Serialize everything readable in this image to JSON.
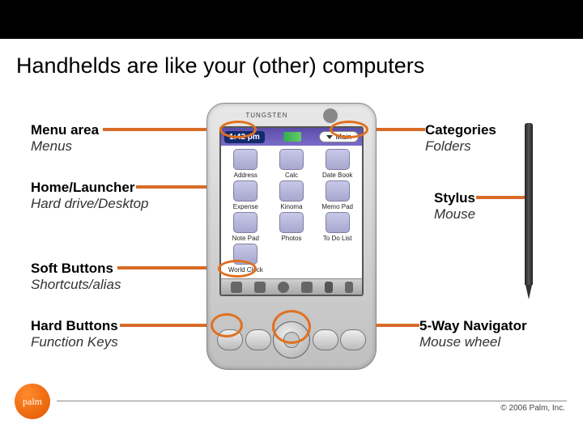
{
  "slide": {
    "title": "Handhelds are like your (other) computers"
  },
  "labels": {
    "menu_area": {
      "primary": "Menu area",
      "secondary": "Menus"
    },
    "home_launcher": {
      "primary": "Home/Launcher",
      "secondary": "Hard drive/Desktop"
    },
    "soft_buttons": {
      "primary": "Soft Buttons",
      "secondary": "Shortcuts/alias"
    },
    "hard_buttons": {
      "primary": "Hard Buttons",
      "secondary": "Function Keys"
    },
    "categories": {
      "primary": "Categories",
      "secondary": "Folders"
    },
    "stylus": {
      "primary": "Stylus",
      "secondary": "Mouse"
    },
    "navigator": {
      "primary": "5-Way Navigator",
      "secondary": "Mouse wheel"
    }
  },
  "device": {
    "model": "TUNGSTEN",
    "time": "1:42 pm",
    "main_button": "Main",
    "apps": [
      "Address",
      "Calc",
      "Date Book",
      "Expense",
      "Kinoma",
      "Memo Pad",
      "Note Pad",
      "Photos",
      "To Do List",
      "World Clock"
    ]
  },
  "footer": {
    "logo_text": "palm",
    "copyright": "© 2006 Palm, Inc."
  }
}
